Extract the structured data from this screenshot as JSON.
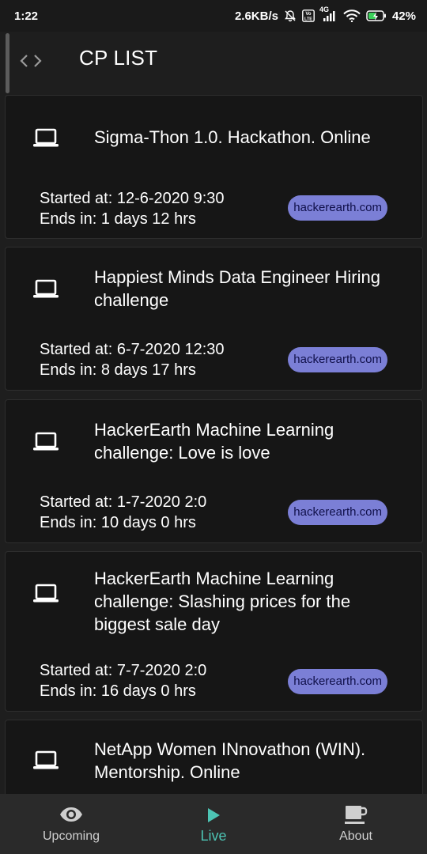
{
  "status_bar": {
    "time": "1:22",
    "network_speed": "2.6KB/s",
    "volte_label": "Vo LTE",
    "network_type": "4G",
    "battery_percent": "42%"
  },
  "app_bar": {
    "title": "CP LIST",
    "icon": "code-icon"
  },
  "contests": [
    {
      "title": "Sigma-Thon 1.0. Hackathon. Online",
      "started": "Started at: 12-6-2020 9:30",
      "ends": "Ends in: 1 days 12 hrs",
      "platform": "hackerearth.com",
      "icon": "laptop-icon"
    },
    {
      "title": "Happiest Minds Data Engineer Hiring challenge",
      "started": "Started at: 6-7-2020 12:30",
      "ends": "Ends in: 8 days 17 hrs",
      "platform": "hackerearth.com",
      "icon": "laptop-icon"
    },
    {
      "title": "HackerEarth Machine Learning challenge: Love is love",
      "started": "Started at: 1-7-2020 2:0",
      "ends": "Ends in: 10 days 0 hrs",
      "platform": "hackerearth.com",
      "icon": "laptop-icon"
    },
    {
      "title": "HackerEarth Machine Learning challenge: Slashing prices for the biggest sale day",
      "started": "Started at: 7-7-2020 2:0",
      "ends": "Ends in: 16 days 0 hrs",
      "platform": "hackerearth.com",
      "icon": "laptop-icon"
    },
    {
      "title": "NetApp Women INnovathon (WIN). Mentorship. Online",
      "started": "",
      "ends": "",
      "platform": "",
      "icon": "laptop-icon"
    }
  ],
  "bottom_nav": {
    "items": [
      {
        "label": "Upcoming",
        "icon": "eye-icon",
        "active": false
      },
      {
        "label": "Live",
        "icon": "play-icon",
        "active": true
      },
      {
        "label": "About",
        "icon": "coffee-icon",
        "active": false
      }
    ]
  },
  "colors": {
    "background": "#1e1e1e",
    "card": "#161616",
    "chip": "#7b7fd6",
    "active_nav": "#4dc4b4"
  }
}
